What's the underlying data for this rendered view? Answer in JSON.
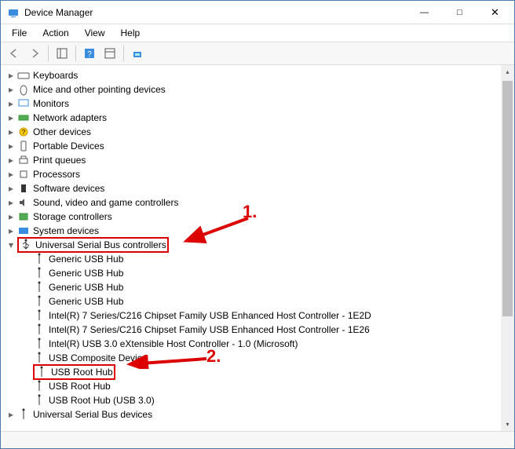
{
  "window": {
    "title": "Device Manager"
  },
  "menus": {
    "file": "File",
    "action": "Action",
    "view": "View",
    "help": "Help"
  },
  "categories": {
    "keyboards": "Keyboards",
    "mice": "Mice and other pointing devices",
    "monitors": "Monitors",
    "network": "Network adapters",
    "other": "Other devices",
    "portable": "Portable Devices",
    "printqueues": "Print queues",
    "processors": "Processors",
    "software": "Software devices",
    "sound": "Sound, video and game controllers",
    "storage": "Storage controllers",
    "system": "System devices",
    "usb_controllers": "Universal Serial Bus controllers",
    "usb_devices": "Universal Serial Bus devices"
  },
  "usb": {
    "generic1": "Generic USB Hub",
    "generic2": "Generic USB Hub",
    "generic3": "Generic USB Hub",
    "generic4": "Generic USB Hub",
    "intel1": "Intel(R) 7 Series/C216 Chipset Family USB Enhanced Host Controller - 1E2D",
    "intel2": "Intel(R) 7 Series/C216 Chipset Family USB Enhanced Host Controller - 1E26",
    "intel3": "Intel(R) USB 3.0 eXtensible Host Controller - 1.0 (Microsoft)",
    "composite": "USB Composite Device",
    "root1": "USB Root Hub",
    "root2": "USB Root Hub",
    "root3": "USB Root Hub (USB 3.0)"
  },
  "annotations": {
    "one": "1.",
    "two": "2."
  }
}
